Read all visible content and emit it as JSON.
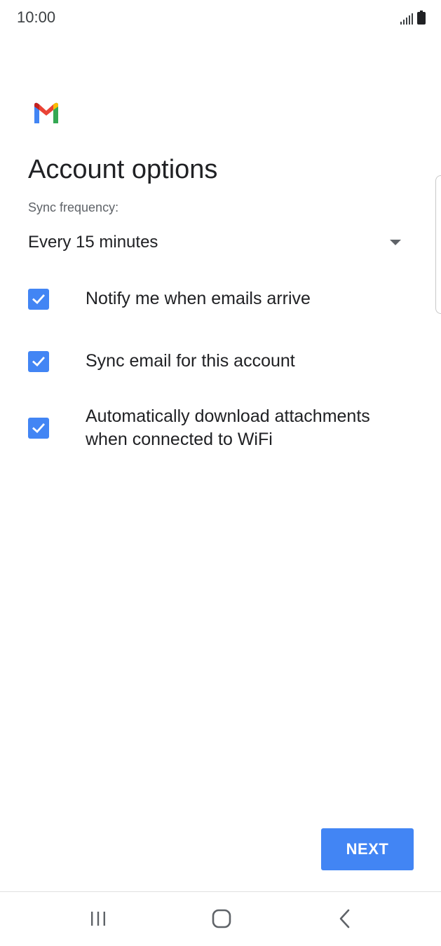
{
  "status_bar": {
    "time": "10:00",
    "icons": [
      "signal-icon",
      "battery-icon"
    ]
  },
  "app": {
    "logo": "gmail-logo-icon"
  },
  "page": {
    "title": "Account options"
  },
  "sync": {
    "label": "Sync frequency:",
    "selected_value": "Every 15 minutes"
  },
  "options": [
    {
      "label": "Notify me when emails arrive",
      "checked": true
    },
    {
      "label": "Sync email for this account",
      "checked": true
    },
    {
      "label": "Automatically download attachments when connected to WiFi",
      "checked": true
    }
  ],
  "actions": {
    "next_label": "NEXT"
  },
  "navigation": {
    "icons": [
      "recents-icon",
      "home-icon",
      "back-icon"
    ]
  },
  "colors": {
    "accent": "#4285f4",
    "text_primary": "#202124",
    "text_secondary": "#5f6368"
  }
}
